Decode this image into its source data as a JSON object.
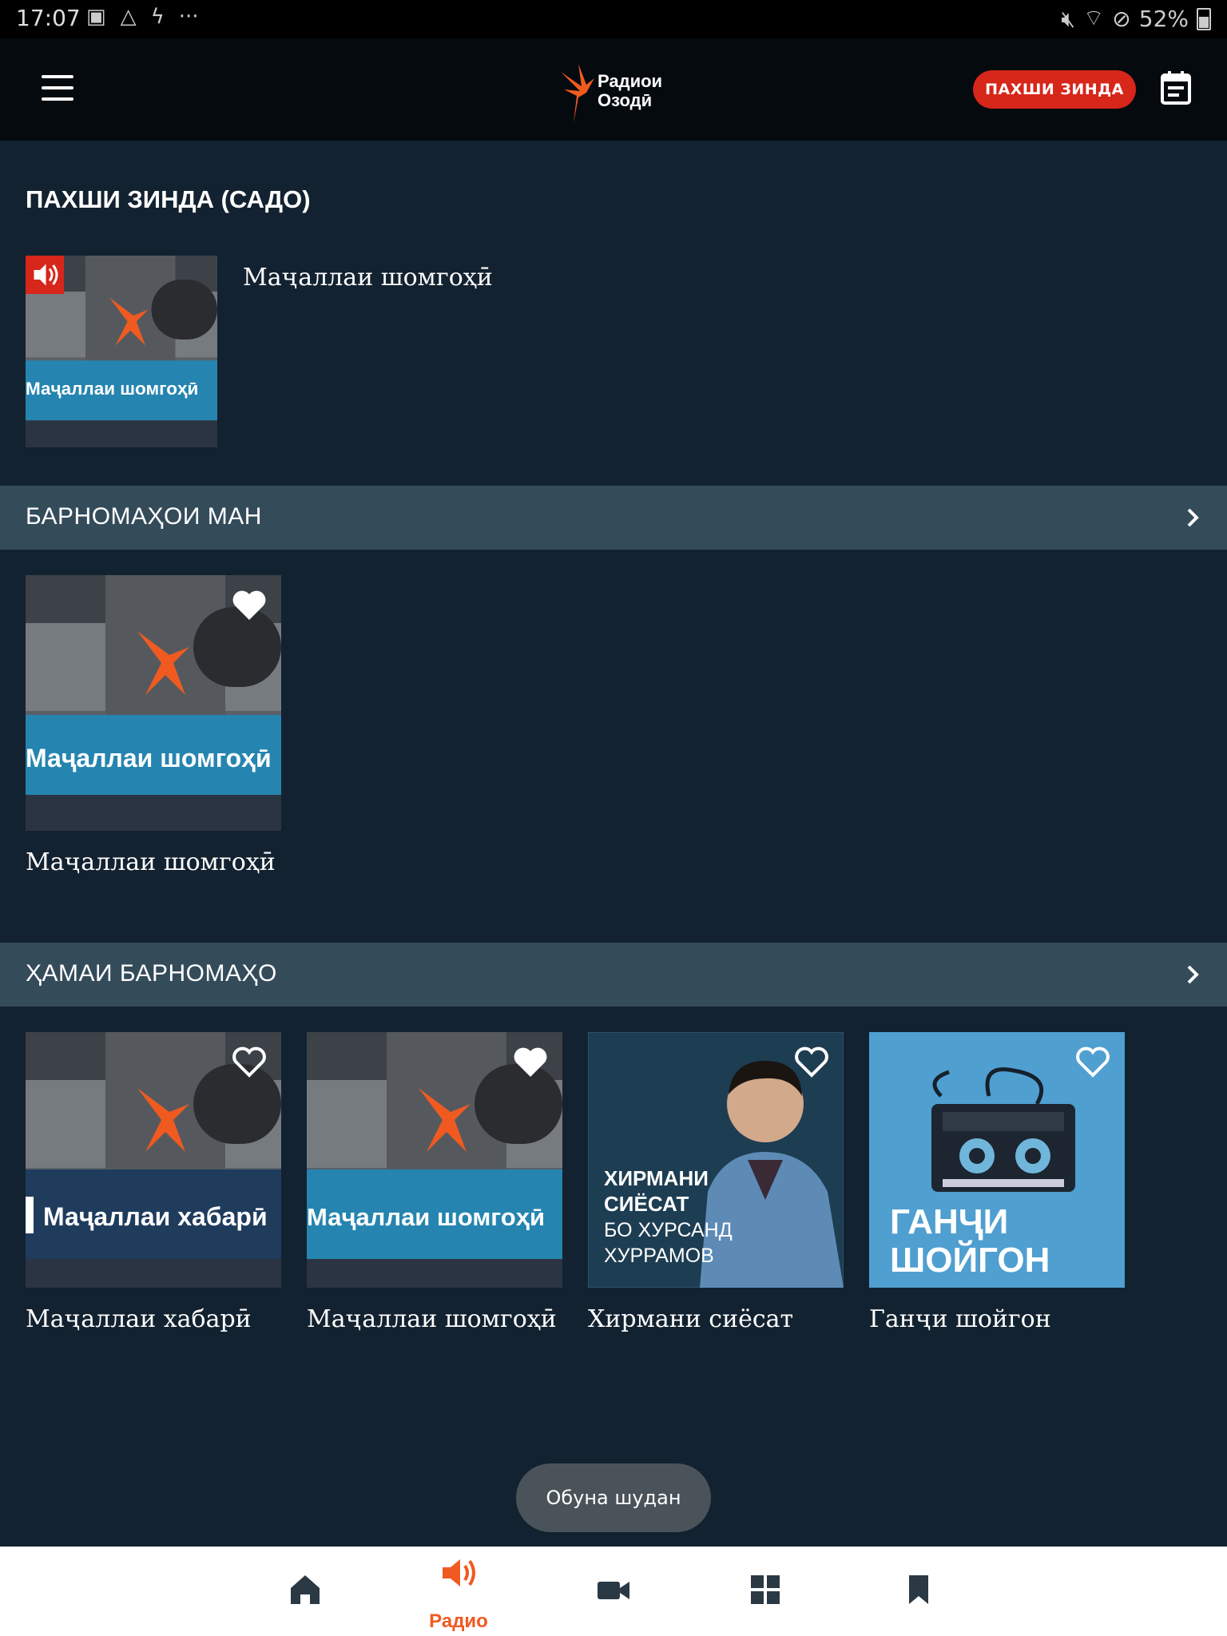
{
  "status_bar": {
    "time": "17:07",
    "battery": "52%"
  },
  "app_bar": {
    "logo_line1": "Радиои",
    "logo_line2": "Озодӣ",
    "live_button": "ПАХШИ ЗИНДА"
  },
  "live_section": {
    "title": "ПАХШИ ЗИНДА (САДО)",
    "program_name": "Маҷаллаи шомгоҳӣ",
    "thumb_text": "Маҷаллаи шомгоҳӣ"
  },
  "my_programs": {
    "header": "БАРНОМАҲОИ МАН",
    "items": [
      {
        "title": "Маҷаллаи шомгоҳӣ",
        "thumb_text": "Маҷаллаи шомгоҳӣ",
        "favorite": true
      }
    ]
  },
  "all_programs": {
    "header": "ҲАМАИ БАРНОМАҲО",
    "items": [
      {
        "title": "Маҷаллаи хабарӣ",
        "thumb_text": "Маҷаллаи хабарӣ",
        "favorite": false
      },
      {
        "title": "Маҷаллаи шомгоҳӣ",
        "thumb_text": "Маҷаллаи шомгоҳӣ",
        "favorite": true
      },
      {
        "title": "Хирмани сиёсат",
        "thumb_line1": "ХИРМАНИ",
        "thumb_line2": "СИЁСАТ",
        "thumb_line3": "БО ХУРСАНД",
        "thumb_line4": "ХУРРАМОВ",
        "favorite": false
      },
      {
        "title": "Ганҷи шойгон",
        "thumb_line1": "ГАНҶИ",
        "thumb_line2": "ШОЙГОН",
        "favorite": false
      }
    ]
  },
  "toast": "Обуна шудан",
  "bottom_nav": {
    "radio_label": "Радио"
  },
  "colors": {
    "accent": "#f05a20",
    "live_red": "#d7261a",
    "background": "#132230",
    "band": "#344b5a"
  }
}
